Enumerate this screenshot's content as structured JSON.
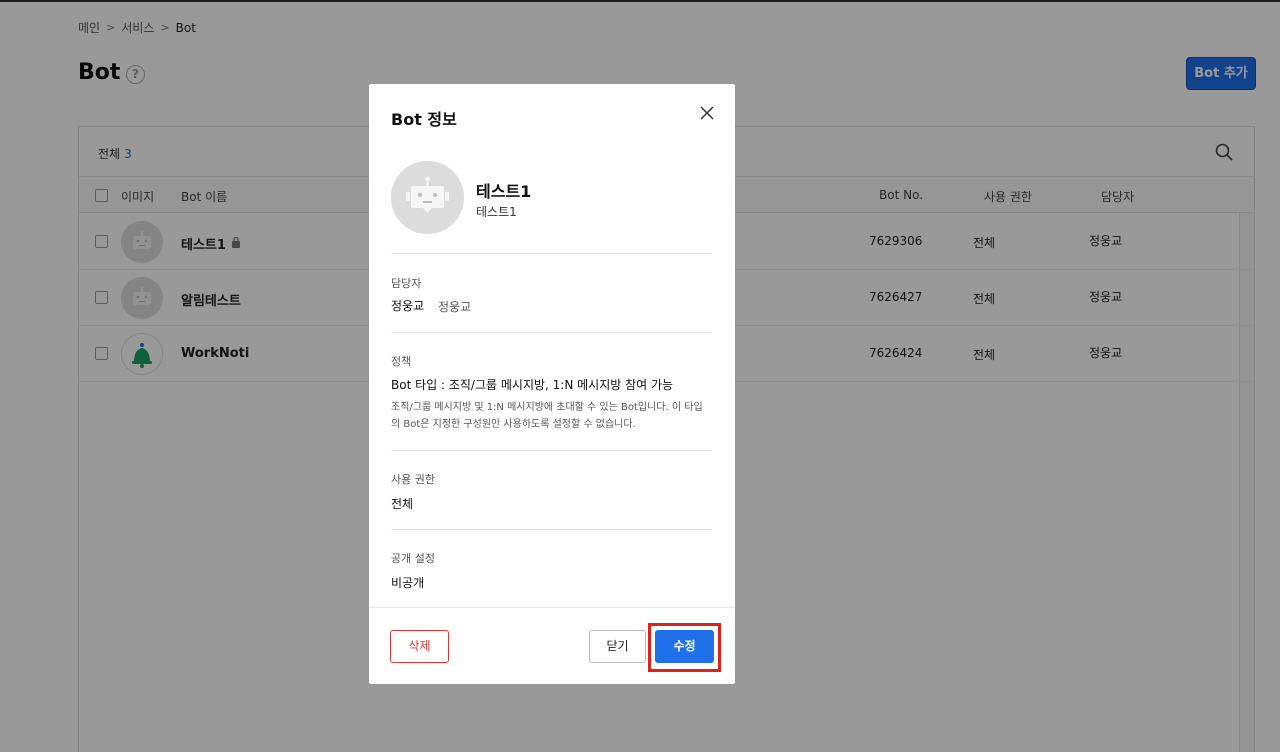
{
  "breadcrumb": {
    "items": [
      "메인",
      "서비스",
      "Bot"
    ],
    "sep": ">"
  },
  "page": {
    "title": "Bot",
    "help": "?",
    "add_button": "Bot 추가"
  },
  "list": {
    "count_label": "전체",
    "count": "3",
    "columns": {
      "image": "이미지",
      "name": "Bot 이름",
      "bot_no": "Bot No.",
      "permission": "사용 권한",
      "owner": "담당자"
    },
    "rows": [
      {
        "name": "테스트1",
        "bot_no": "7629306",
        "permission": "전체",
        "owner": "정웅교",
        "locked": true,
        "icon": "robot-avatar-icon"
      },
      {
        "name": "알림테스트",
        "bot_no": "7626427",
        "permission": "전체",
        "owner": "정웅교",
        "locked": false,
        "icon": "robot-avatar-icon"
      },
      {
        "name": "WorkNoti",
        "bot_no": "7626424",
        "permission": "전체",
        "owner": "정웅교",
        "locked": false,
        "icon": "bell-avatar-icon"
      }
    ]
  },
  "modal": {
    "title": "Bot 정보",
    "bot_name": "테스트1",
    "bot_desc": "테스트1",
    "owner_label": "담당자",
    "owner_name": "정웅교",
    "owner_id": "정웅교",
    "policy_label": "정책",
    "policy_value": "Bot 타입 : 조직/그룹 메시지방, 1:N 메시지방 참여 가능",
    "policy_desc_line1": "조직/그룹 메시지방 및 1:N 메시지방에 초대할 수 있는 Bot입니다. 이 타입",
    "policy_desc_line2": "의 Bot은 지정한 구성원만 사용하도록 설정할 수 없습니다.",
    "permission_label": "사용 권한",
    "permission_value": "전체",
    "visibility_label": "공개 설정",
    "visibility_value": "비공개",
    "delete_button": "삭제",
    "close_button": "닫기",
    "edit_button": "수정"
  },
  "colors": {
    "accent": "#1f6fe8",
    "danger": "#dd3333",
    "highlight": "#e0201a"
  }
}
